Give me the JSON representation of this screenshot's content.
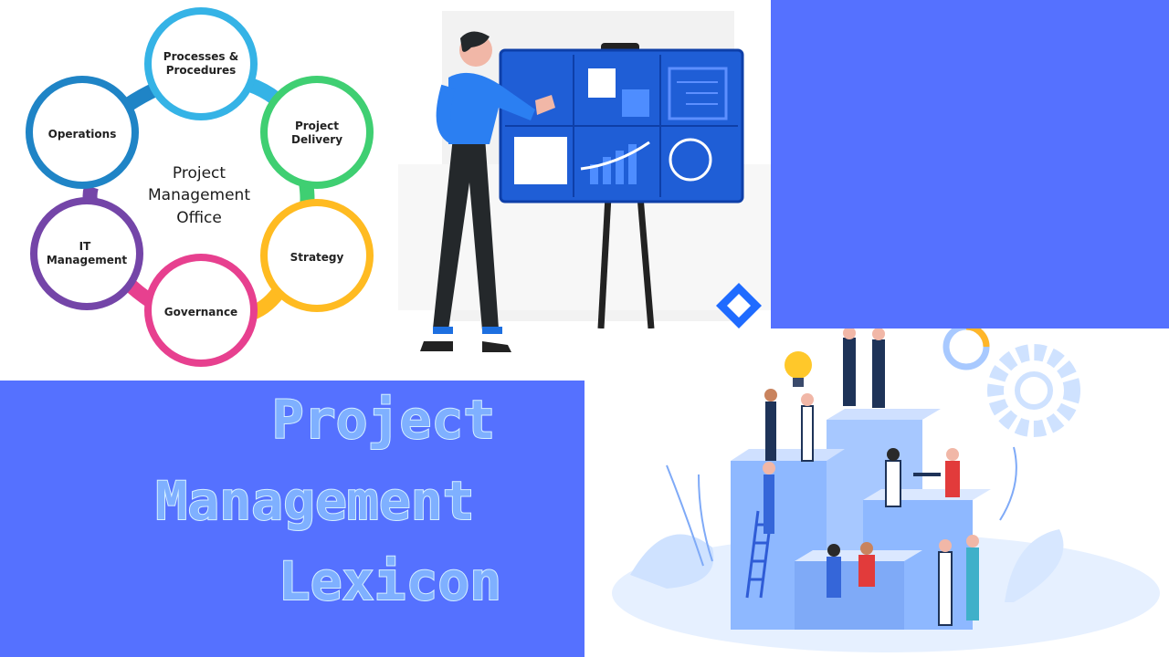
{
  "pmo": {
    "center": [
      "Project",
      "Management",
      "Office"
    ],
    "nodes": [
      {
        "lines": [
          "Processes &",
          "Procedures"
        ],
        "color": "#35b3e6"
      },
      {
        "lines": [
          "Project",
          "Delivery"
        ],
        "color": "#3fcf72"
      },
      {
        "lines": [
          "Strategy"
        ],
        "color": "#ffbb21"
      },
      {
        "lines": [
          "Governance"
        ],
        "color": "#e7408f"
      },
      {
        "lines": [
          "IT",
          "Management"
        ],
        "color": "#7445a8"
      },
      {
        "lines": [
          "Operations"
        ],
        "color": "#1f84c6"
      }
    ]
  },
  "title": {
    "line1": "Project",
    "line2": "Management",
    "line3": "Lexicon"
  },
  "colors": {
    "blue_bg": "#5571ff",
    "board_blue": "#1f5ed6"
  }
}
